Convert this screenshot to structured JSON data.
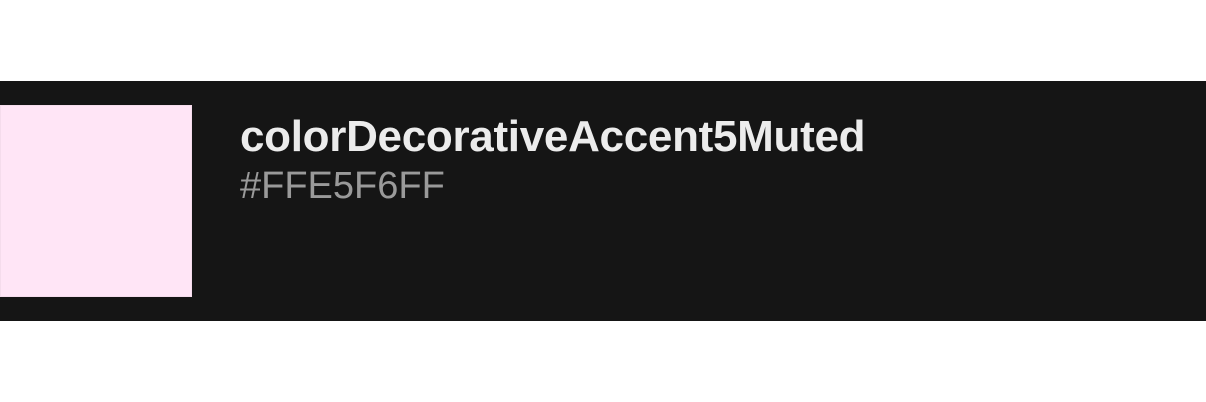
{
  "token": {
    "name": "colorDecorativeAccent5Muted",
    "value": "#FFE5F6FF",
    "swatch_color": "#FFE5F6"
  },
  "colors": {
    "row_background": "#151515",
    "name_text": "#ECECEC",
    "value_text": "#9A9A9A",
    "page_background": "#FFFFFF"
  }
}
